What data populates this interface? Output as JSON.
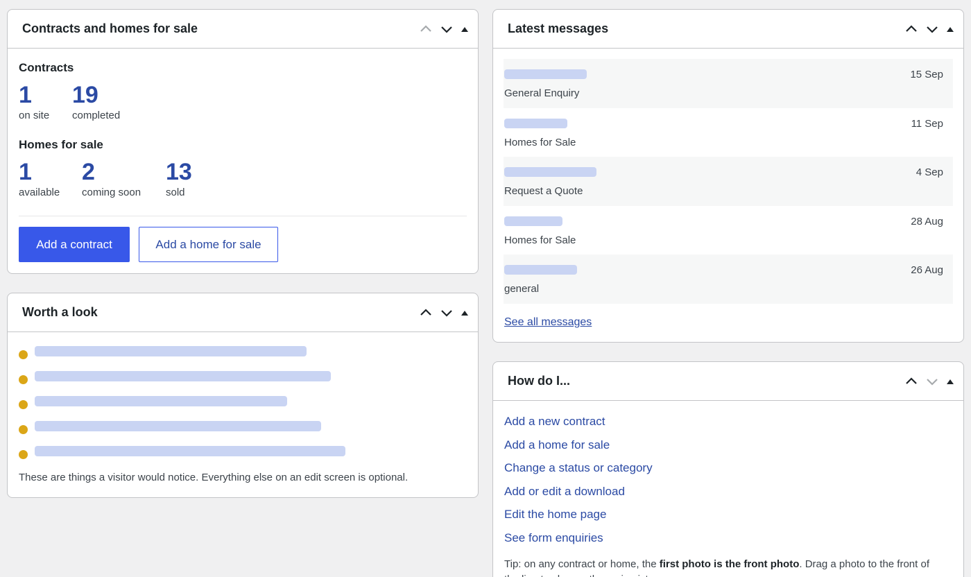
{
  "contracts_panel": {
    "title": "Contracts and homes for sale",
    "contracts_label": "Contracts",
    "contracts_stats": [
      {
        "value": "1",
        "label": "on site"
      },
      {
        "value": "19",
        "label": "completed"
      }
    ],
    "homes_label": "Homes for sale",
    "homes_stats": [
      {
        "value": "1",
        "label": "available"
      },
      {
        "value": "2",
        "label": "coming soon"
      },
      {
        "value": "13",
        "label": "sold"
      }
    ],
    "add_contract_label": "Add a contract",
    "add_home_label": "Add a home for sale"
  },
  "worth_panel": {
    "title": "Worth a look",
    "note": "These are things a visitor would notice. Everything else on an edit screen is optional."
  },
  "messages_panel": {
    "title": "Latest messages",
    "messages": [
      {
        "date": "15 Sep",
        "subject": "General Enquiry"
      },
      {
        "date": "11 Sep",
        "subject": "Homes for Sale"
      },
      {
        "date": "4 Sep",
        "subject": "Request a Quote"
      },
      {
        "date": "28 Aug",
        "subject": "Homes for Sale"
      },
      {
        "date": "26 Aug",
        "subject": "general"
      }
    ],
    "see_all_label": "See all messages"
  },
  "howto_panel": {
    "title": "How do I...",
    "links": [
      "Add a new contract",
      "Add a home for sale",
      "Change a status or category",
      "Add or edit a download",
      "Edit the home page",
      "See form enquiries"
    ],
    "tip_prefix": "Tip: on any contract or home, the ",
    "tip_bold": "first photo is the front photo",
    "tip_suffix": ". Drag a photo to the front of the line to change the main picture."
  },
  "icons": {
    "move_up": "chevron-up-icon",
    "move_down": "chevron-down-icon",
    "toggle": "triangle-up-icon"
  },
  "colors": {
    "accent": "#3858e9",
    "link": "#2b4aa4",
    "dot": "#dba617",
    "placeholder": "#c9d4f3"
  }
}
